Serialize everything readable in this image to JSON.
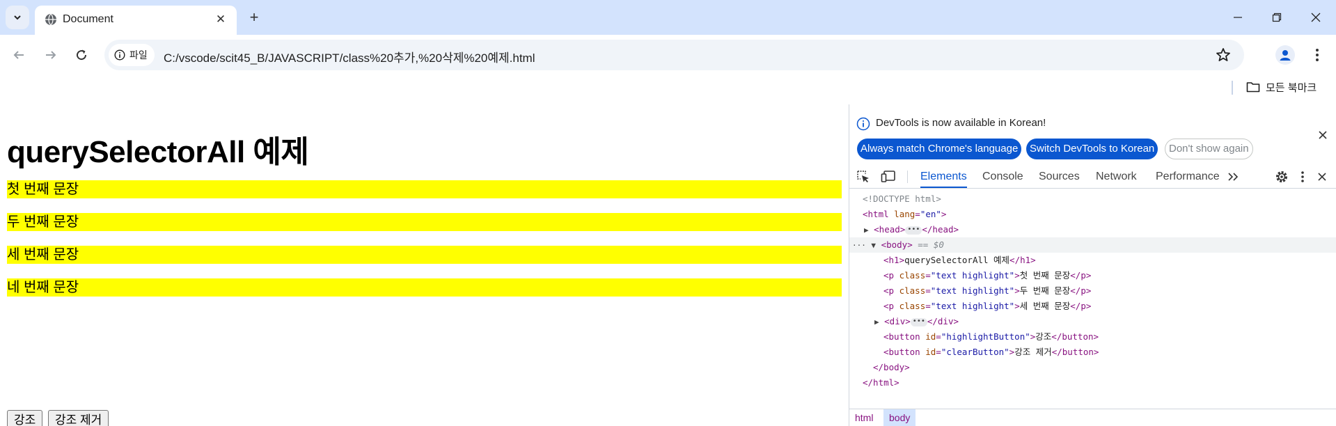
{
  "browser": {
    "tab_title": "Document",
    "url": "C:/vscode/scit45_B/JAVASCRIPT/class%20추가,%20삭제%20예제.html",
    "site_info_label": "파일",
    "bookmarks_all_label": "모든 북마크"
  },
  "page": {
    "heading": "querySelectorAll 예제",
    "paragraphs": [
      "첫 번째 문장",
      "두 번째 문장",
      "세 번째 문장",
      "네 번째 문장"
    ],
    "highlight_color": "#ffff00",
    "buttons": {
      "highlight": "강조",
      "clear": "강조 제거"
    }
  },
  "devtools": {
    "info_message": "DevTools is now available in Korean!",
    "info_buttons": {
      "always_match": "Always match Chrome's language",
      "switch": "Switch DevTools to Korean",
      "dont_show": "Don't show again"
    },
    "tabs": [
      "Elements",
      "Console",
      "Sources",
      "Network",
      "Performance"
    ],
    "active_tab": "Elements",
    "dom": {
      "doctype": "<!DOCTYPE html>",
      "html_open_tag": "<html",
      "lang_attr": "lang",
      "lang_value": "\"en\"",
      "head_open": "<head>",
      "head_close": "</head>",
      "body_open": "<body>",
      "selected_marker": "== $0",
      "h1_open": "<h1>",
      "h1_text": "querySelectorAll 예제",
      "h1_close": "</h1>",
      "p_lines": [
        {
          "text": "첫 번째 문장"
        },
        {
          "text": "두 번째 문장"
        },
        {
          "text": "세 번째 문장"
        }
      ],
      "p_open": "<p",
      "p_class_attr": "class",
      "p_class_value": "\"text highlight\"",
      "p_close": "</p>",
      "div_open": "<div>",
      "div_close": "</div>",
      "button_open": "<button",
      "button_id_attr": "id",
      "button_close": "</button>",
      "buttons": [
        {
          "id": "\"highlightButton\"",
          "text": "강조"
        },
        {
          "id": "\"clearButton\"",
          "text": "강조 제거"
        }
      ],
      "body_close": "</body>",
      "html_close": "</html>"
    },
    "breadcrumbs": [
      "html",
      "body"
    ]
  },
  "colors": {
    "titlebar": "#d3e3fd",
    "accent": "#0b57d0",
    "tag": "#881280",
    "attr": "#994500",
    "value": "#1a1aa6"
  }
}
